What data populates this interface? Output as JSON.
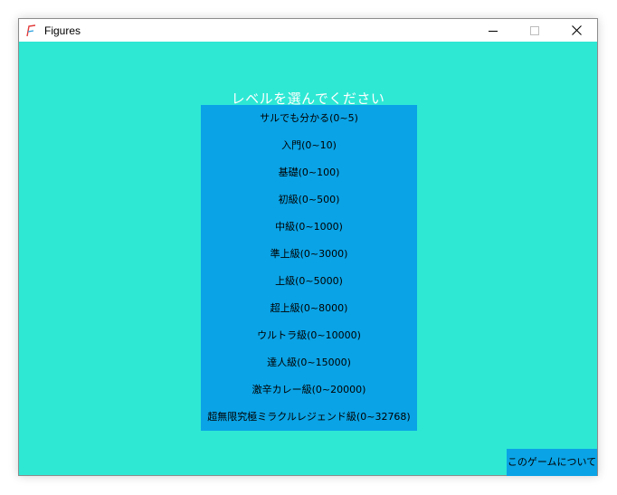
{
  "window": {
    "title": "Figures"
  },
  "colors": {
    "background": "#2ee8d4",
    "panel": "#0aa3e6",
    "prompt_text": "#ffffff"
  },
  "prompt": "レベルを選んでください",
  "levels": [
    "サルでも分かる(0~5)",
    "入門(0~10)",
    "基礎(0~100)",
    "初級(0~500)",
    "中級(0~1000)",
    "準上級(0~3000)",
    "上級(0~5000)",
    "超上級(0~8000)",
    "ウルトラ級(0~10000)",
    "達人級(0~15000)",
    "激辛カレー級(0~20000)",
    "超無限究極ミラクルレジェンド級(0~32768)"
  ],
  "about_button": "このゲームについて",
  "icons": {
    "app": "figures-app-icon",
    "minimize": "minimize-icon",
    "maximize": "maximize-icon",
    "close": "close-icon"
  }
}
